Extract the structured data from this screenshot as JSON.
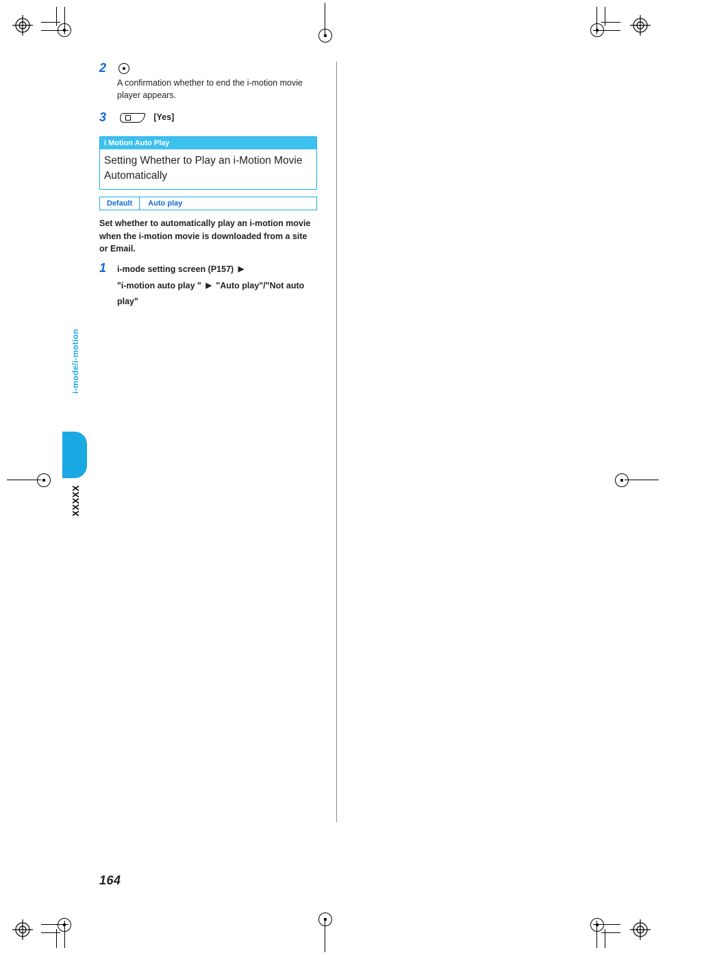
{
  "page_number": "164",
  "side_tab_label": "i-mode/i-motion",
  "side_placeholder": "XXXXX",
  "steps_top": [
    {
      "num": "2",
      "key": "center",
      "desc": "A confirmation whether to end the i-motion movie player appears."
    },
    {
      "num": "3",
      "key": "softkey",
      "label": "[Yes]"
    }
  ],
  "section": {
    "tag": "i Motion Auto Play",
    "title": "Setting Whether to Play an i-Motion Movie Automatically"
  },
  "default_row": {
    "label": "Default",
    "value": "Auto play"
  },
  "lede": "Set whether to automatically play an i-motion movie when the i-motion movie is downloaded from a site or Email.",
  "procedure": {
    "num": "1",
    "part1": "i-mode setting screen (P157)",
    "part2": "\"i-motion auto play \"",
    "part3": "\"Auto play\"/\"Not auto play\""
  }
}
